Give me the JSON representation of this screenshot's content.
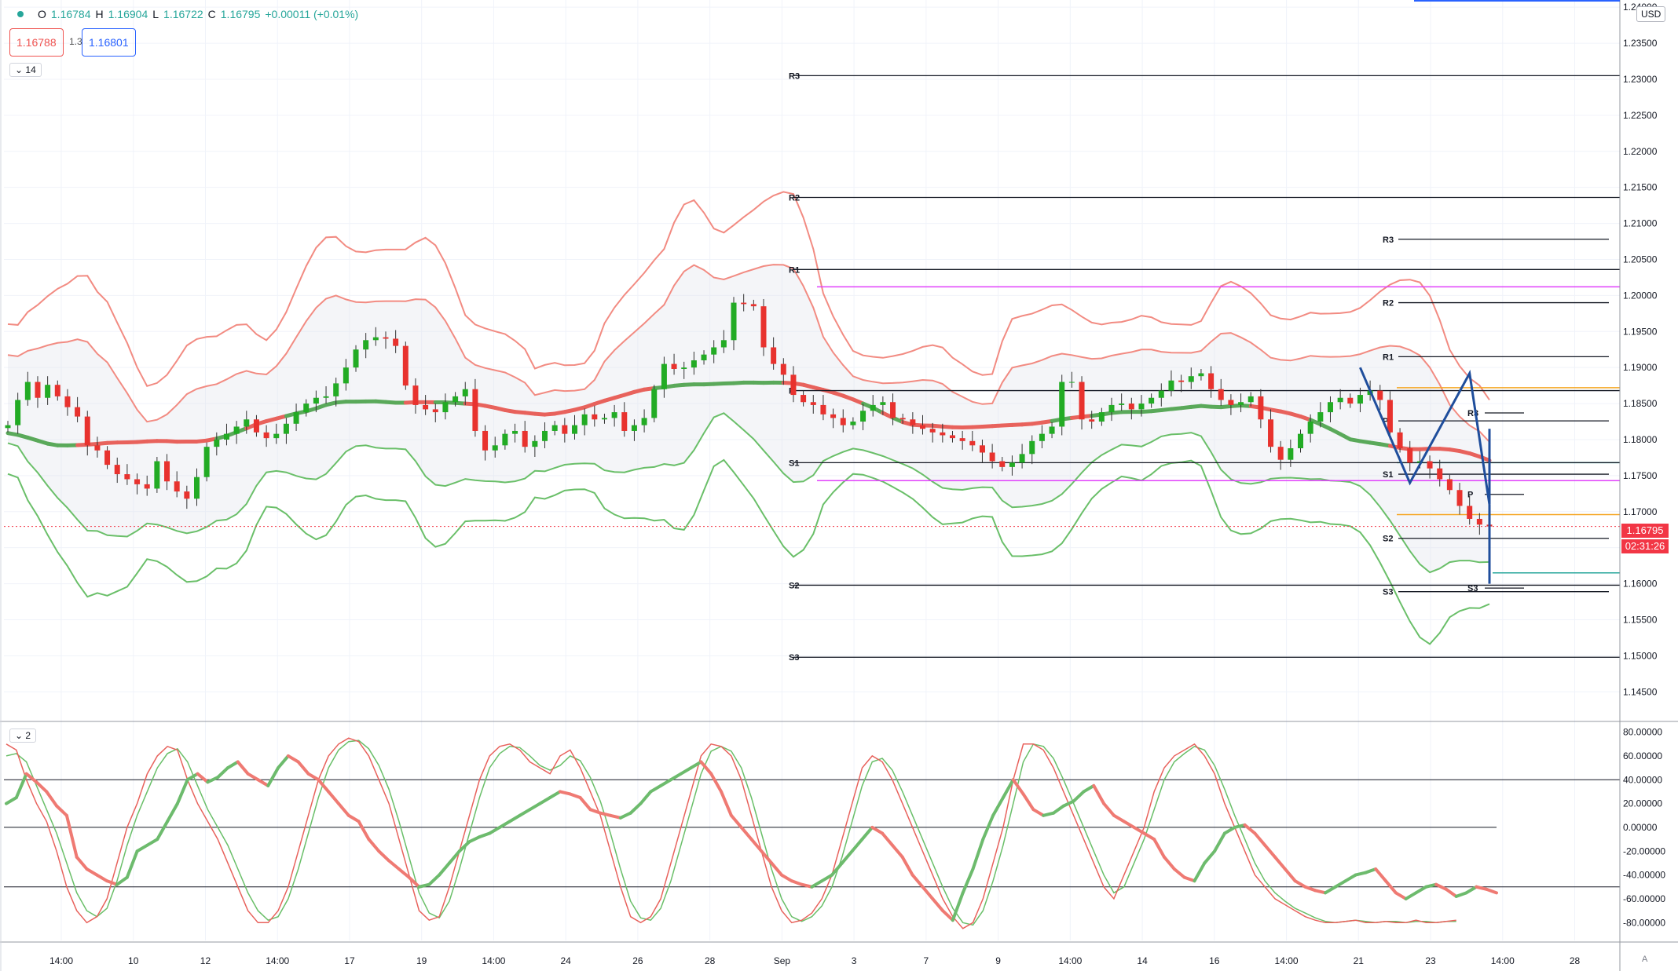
{
  "header": {
    "open_label": "O",
    "open_value": "1.16784",
    "high_label": "H",
    "high_value": "1.16904",
    "low_label": "L",
    "low_value": "1.16722",
    "close_label": "C",
    "close_value": "1.16795",
    "change_value": "+0.00011 (+0.01%)",
    "sell_price": "1.16788",
    "spread": "1.3",
    "buy_price": "1.16801",
    "main_indicator_count": "14",
    "osc_indicator_count": "2",
    "currency": "USD",
    "last_price_tag": "1.16795",
    "countdown_tag": "02:31:26",
    "auto_label": "A"
  },
  "chart_data": [
    {
      "type": "candlestick",
      "price_axis_labels": [
        "1.24000",
        "1.23500",
        "1.23000",
        "1.22500",
        "1.22000",
        "1.21500",
        "1.21000",
        "1.20500",
        "1.20000",
        "1.19500",
        "1.19000",
        "1.18500",
        "1.18000",
        "1.17500",
        "1.17000",
        "1.16500",
        "1.16000",
        "1.15500",
        "1.15000",
        "1.14500"
      ],
      "ylim": [
        1.141,
        1.241
      ],
      "time_axis_labels": [
        "14:00",
        "10",
        "12",
        "14:00",
        "17",
        "19",
        "14:00",
        "24",
        "26",
        "28",
        "Sep",
        "3",
        "7",
        "9",
        "14:00",
        "14",
        "16",
        "14:00",
        "21",
        "23",
        "14:00",
        "28"
      ],
      "pivot_sets": [
        {
          "labels": [
            "R3",
            "R2",
            "R1",
            "P",
            "S1",
            "S2",
            "S3"
          ],
          "values": [
            1.2305,
            1.2136,
            1.2036,
            1.1868,
            1.1768,
            1.1598,
            1.1498
          ]
        },
        {
          "labels": [
            "R3",
            "R2",
            "R1",
            "P",
            "S1",
            "S2",
            "S3"
          ],
          "values": [
            1.2078,
            1.199,
            1.1915,
            1.1826,
            1.1752,
            1.1663,
            1.1589
          ]
        },
        {
          "labels": [
            "R3",
            "P",
            "S3"
          ],
          "values": [
            1.1837,
            1.1724,
            1.1594
          ]
        }
      ],
      "horizontal_levels": [
        {
          "value": 1.2012,
          "color": "#e040fb"
        },
        {
          "value": 1.1743,
          "color": "#e040fb"
        },
        {
          "value": 1.1872,
          "color": "#f5a623"
        },
        {
          "value": 1.1696,
          "color": "#f5a623"
        },
        {
          "value": 1.1768,
          "color": "#26a69a"
        },
        {
          "value": 1.1615,
          "color": "#26a69a"
        }
      ],
      "last_price": 1.16795,
      "close_series": [
        1.182,
        1.1855,
        1.188,
        1.1858,
        1.1876,
        1.186,
        1.1845,
        1.1832,
        1.1792,
        1.1785,
        1.1765,
        1.1752,
        1.1745,
        1.1738,
        1.1732,
        1.177,
        1.1742,
        1.1728,
        1.1718,
        1.1748,
        1.179,
        1.18,
        1.1808,
        1.1818,
        1.1828,
        1.181,
        1.1802,
        1.1808,
        1.1822,
        1.1838,
        1.185,
        1.1858,
        1.186,
        1.1878,
        1.19,
        1.1925,
        1.1938,
        1.1942,
        1.194,
        1.193,
        1.1875,
        1.1848,
        1.1842,
        1.1838,
        1.1852,
        1.186,
        1.187,
        1.1812,
        1.1785,
        1.1792,
        1.1808,
        1.1812,
        1.179,
        1.1798,
        1.1812,
        1.182,
        1.1808,
        1.182,
        1.1835,
        1.1828,
        1.183,
        1.1838,
        1.1812,
        1.182,
        1.183,
        1.187,
        1.1905,
        1.1898,
        1.19,
        1.191,
        1.1918,
        1.1928,
        1.1938,
        1.199,
        1.1988,
        1.1985,
        1.1928,
        1.1905,
        1.189,
        1.1862,
        1.1852,
        1.1848,
        1.1835,
        1.183,
        1.182,
        1.1825,
        1.184,
        1.1848,
        1.1852,
        1.183,
        1.1828,
        1.182,
        1.1815,
        1.181,
        1.1806,
        1.1802,
        1.1798,
        1.1792,
        1.1782,
        1.177,
        1.1762,
        1.1768,
        1.178,
        1.1798,
        1.1808,
        1.1818,
        1.188,
        1.188,
        1.1828,
        1.1825,
        1.1838,
        1.1848,
        1.185,
        1.1842,
        1.185,
        1.1858,
        1.1868,
        1.1882,
        1.188,
        1.1888,
        1.1892,
        1.187,
        1.1855,
        1.1848,
        1.1852,
        1.186,
        1.1828,
        1.179,
        1.1772,
        1.1788,
        1.1808,
        1.1825,
        1.1838,
        1.1852,
        1.1858,
        1.185,
        1.1862,
        1.1868,
        1.1855,
        1.181,
        1.1788,
        1.1768,
        1.177,
        1.176,
        1.1745,
        1.173,
        1.1708,
        1.169,
        1.1682,
        1.16795
      ],
      "oscillator": {
        "ylim": [
          -95,
          87
        ],
        "axis_labels": [
          "80.00000",
          "60.00000",
          "40.00000",
          "20.00000",
          "0.00000",
          "-20.00000",
          "-40.00000",
          "-60.00000",
          "-80.00000"
        ],
        "levels": [
          40,
          0,
          -50
        ],
        "thick_series": [
          20,
          25,
          45,
          38,
          30,
          18,
          10,
          -25,
          -35,
          -40,
          -45,
          -48,
          -42,
          -20,
          -15,
          -10,
          5,
          20,
          40,
          45,
          38,
          42,
          50,
          55,
          45,
          40,
          35,
          50,
          60,
          55,
          45,
          40,
          30,
          20,
          10,
          5,
          -10,
          -20,
          -28,
          -35,
          -42,
          -50,
          -48,
          -40,
          -30,
          -20,
          -12,
          -8,
          -5,
          0,
          5,
          10,
          15,
          20,
          25,
          30,
          28,
          25,
          15,
          12,
          10,
          8,
          12,
          20,
          30,
          35,
          40,
          45,
          50,
          55,
          45,
          30,
          10,
          0,
          -10,
          -20,
          -30,
          -40,
          -45,
          -48,
          -50,
          -45,
          -40,
          -30,
          -20,
          -10,
          0,
          -5,
          -15,
          -25,
          -40,
          -50,
          -60,
          -70,
          -78,
          -55,
          -35,
          -10,
          10,
          25,
          40,
          28,
          15,
          10,
          12,
          18,
          22,
          30,
          35,
          20,
          10,
          5,
          0,
          -5,
          -10,
          -25,
          -35,
          -42,
          -45,
          -30,
          -20,
          -5,
          0,
          2,
          -5,
          -15,
          -25,
          -35,
          -45,
          -50,
          -53,
          -55,
          -50,
          -45,
          -40,
          -38,
          -35,
          -45,
          -55,
          -60,
          -55,
          -50,
          -48,
          -52,
          -58,
          -55,
          -50,
          -52,
          -55
        ],
        "fast_series": [
          70,
          65,
          40,
          20,
          5,
          -20,
          -50,
          -70,
          -80,
          -75,
          -60,
          -30,
          0,
          20,
          45,
          60,
          68,
          65,
          40,
          20,
          5,
          -10,
          -30,
          -50,
          -70,
          -80,
          -80,
          -70,
          -50,
          -20,
          10,
          40,
          60,
          70,
          75,
          72,
          60,
          40,
          20,
          -10,
          -40,
          -70,
          -78,
          -75,
          -50,
          -20,
          10,
          40,
          60,
          68,
          70,
          65,
          55,
          50,
          45,
          60,
          65,
          50,
          30,
          10,
          -20,
          -50,
          -75,
          -80,
          -75,
          -60,
          -30,
          0,
          30,
          60,
          70,
          68,
          60,
          40,
          10,
          -20,
          -50,
          -70,
          -80,
          -78,
          -72,
          -60,
          -40,
          -10,
          20,
          50,
          60,
          55,
          40,
          20,
          0,
          -20,
          -40,
          -60,
          -75,
          -85,
          -80,
          -60,
          -30,
          0,
          40,
          70,
          70,
          65,
          50,
          30,
          10,
          -10,
          -30,
          -50,
          -60,
          -40,
          -20,
          0,
          30,
          50,
          60,
          65,
          70,
          60,
          45,
          20,
          0,
          -20,
          -40,
          -50,
          -60,
          -65,
          -70,
          -75,
          -78,
          -80,
          -80,
          -79,
          -78,
          -80,
          -80,
          -79,
          -80,
          -80,
          -78,
          -80,
          -80,
          -79,
          -78
        ],
        "slow_series": [
          60,
          62,
          55,
          35,
          15,
          -5,
          -30,
          -55,
          -70,
          -75,
          -68,
          -45,
          -15,
          10,
          30,
          50,
          62,
          66,
          55,
          35,
          15,
          0,
          -15,
          -35,
          -55,
          -70,
          -78,
          -75,
          -60,
          -35,
          -5,
          25,
          50,
          65,
          72,
          73,
          66,
          52,
          32,
          5,
          -25,
          -55,
          -72,
          -76,
          -62,
          -35,
          -5,
          25,
          50,
          62,
          68,
          67,
          60,
          52,
          48,
          52,
          60,
          56,
          42,
          22,
          -5,
          -35,
          -62,
          -76,
          -78,
          -68,
          -45,
          -15,
          15,
          45,
          64,
          68,
          64,
          50,
          25,
          -5,
          -35,
          -60,
          -75,
          -79,
          -75,
          -66,
          -50,
          -25,
          5,
          35,
          55,
          58,
          48,
          30,
          10,
          -10,
          -30,
          -50,
          -68,
          -80,
          -82,
          -70,
          -45,
          -15,
          20,
          55,
          70,
          68,
          58,
          40,
          20,
          0,
          -20,
          -40,
          -55,
          -50,
          -30,
          -10,
          15,
          40,
          55,
          62,
          68,
          65,
          52,
          32,
          10,
          -10,
          -30,
          -45,
          -55,
          -62,
          -68,
          -72,
          -76,
          -79,
          -80,
          -79,
          -78,
          -79,
          -80,
          -79,
          -79,
          -80,
          -79,
          -79,
          -80,
          -79,
          -79
        ]
      }
    }
  ]
}
